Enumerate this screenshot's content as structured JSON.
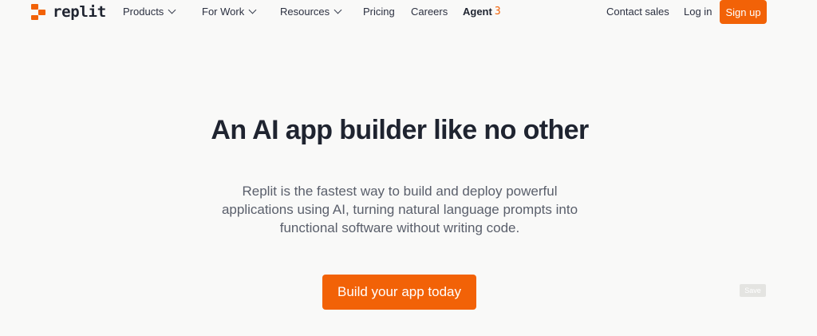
{
  "nav": {
    "logo_text": "replit",
    "items": [
      {
        "label": "Products"
      },
      {
        "label": "For Work"
      },
      {
        "label": "Resources"
      },
      {
        "label": "Pricing"
      },
      {
        "label": "Careers"
      }
    ],
    "agent": {
      "label": "Agent",
      "number": "3"
    },
    "contact_sales": "Contact sales",
    "log_in": "Log in",
    "sign_up": "Sign up"
  },
  "hero": {
    "title": "An AI app builder like no other",
    "description": "Replit is the fastest way to build and deploy powerful applications using AI, turning natural language prompts into functional software without writing code.",
    "cta_label": "Build your app today"
  },
  "save_chip": "Save",
  "colors": {
    "brand": "#f26207",
    "text": "#1f2430",
    "muted": "#5a5f6b",
    "background": "#f9f9f8"
  }
}
